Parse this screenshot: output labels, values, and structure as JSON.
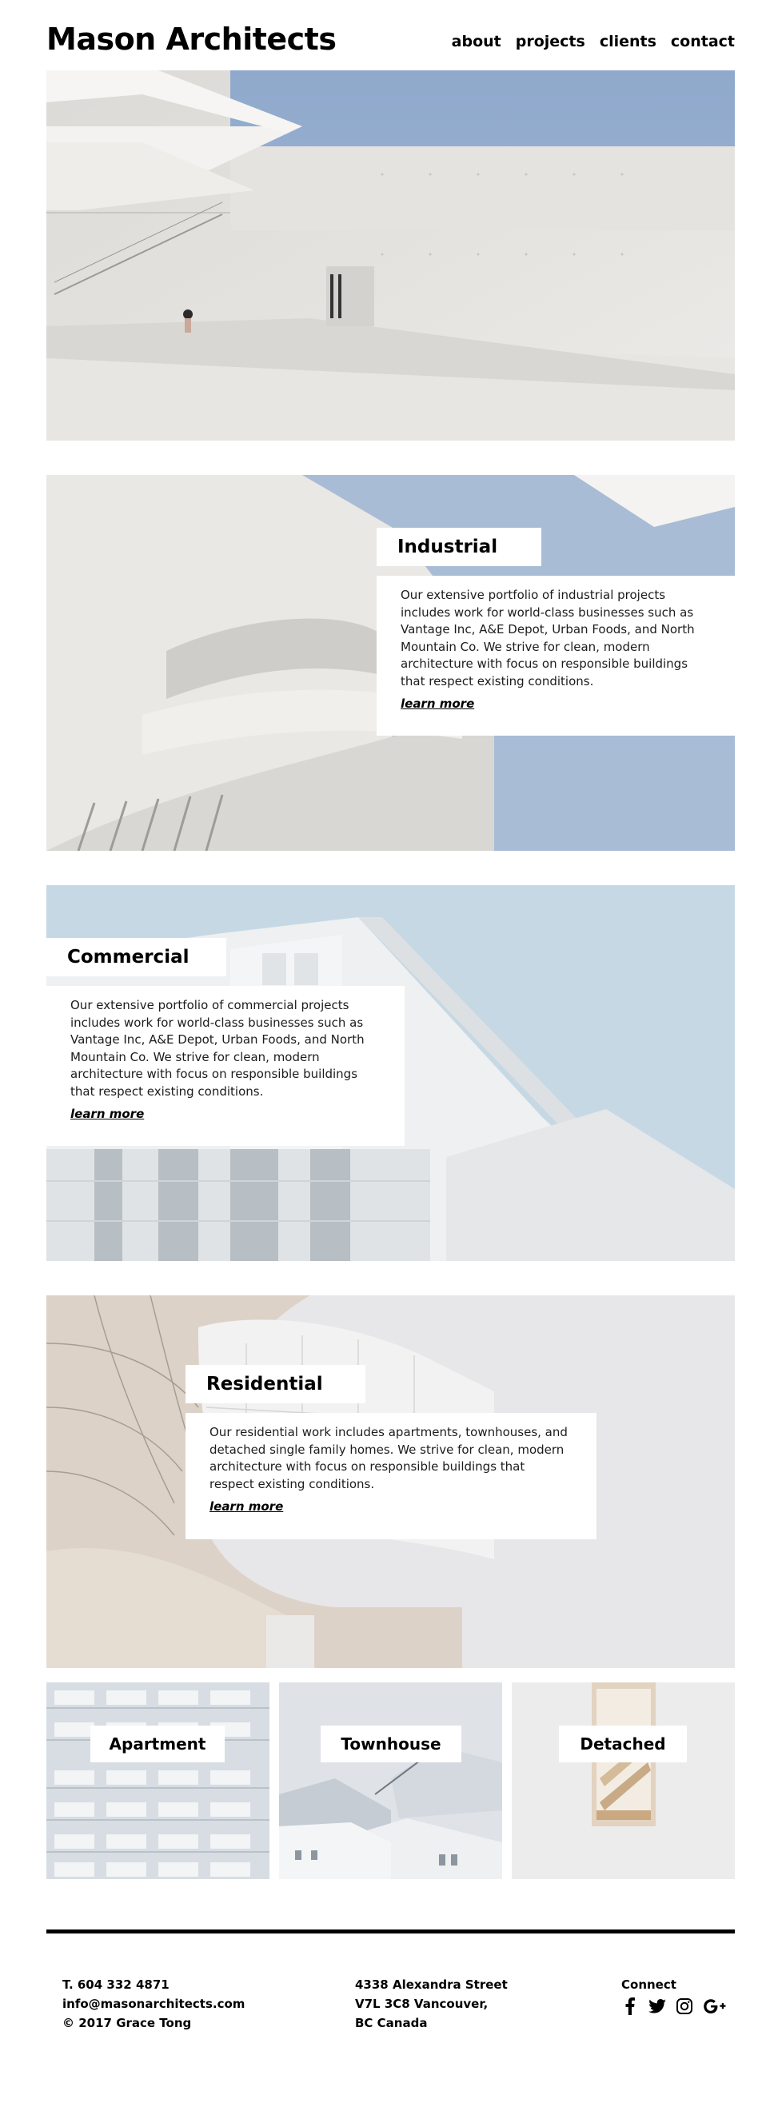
{
  "header": {
    "brand": "Mason Architects",
    "nav": [
      "about",
      "projects",
      "clients",
      "contact"
    ]
  },
  "sections": {
    "industrial": {
      "title": "Industrial",
      "body": "Our extensive portfolio of industrial projects includes work for world-class businesses such as Vantage Inc, A&E Depot, Urban Foods, and North Mountain Co. We strive for clean, modern architecture with focus on responsible buildings that respect existing conditions.",
      "link": "learn more"
    },
    "commercial": {
      "title": "Commercial",
      "body": "Our extensive portfolio of commercial projects includes work for world-class businesses such as Vantage Inc, A&E Depot, Urban Foods, and North Mountain Co. We strive for clean, modern architecture with focus on responsible buildings that respect existing conditions.",
      "link": "learn more"
    },
    "residential": {
      "title": "Residential",
      "body": "Our residential work includes apartments, townhouses, and detached single family homes. We strive for clean, modern architecture with focus on responsible buildings that respect existing conditions.",
      "link": "learn more"
    }
  },
  "tiles": [
    "Apartment",
    "Townhouse",
    "Detached"
  ],
  "footer": {
    "phone": "T. 604 332 4871",
    "email": "info@masonarchitects.com",
    "copyright": "© 2017 Grace Tong",
    "address_line1": "4338 Alexandra Street",
    "address_line2": "V7L 3C8 Vancouver,",
    "address_line3": "BC Canada",
    "connect": "Connect",
    "social_icons": [
      "facebook-icon",
      "twitter-icon",
      "instagram-icon",
      "google-plus-icon"
    ]
  },
  "colors": {
    "sky": "#a9bcd6",
    "concrete": "#e9e7e4",
    "text": "#111111"
  }
}
